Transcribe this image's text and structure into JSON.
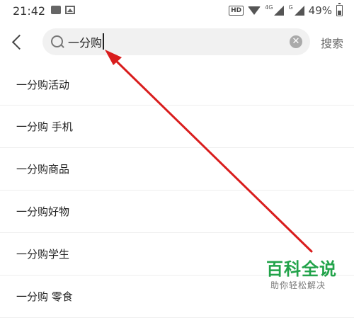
{
  "status_bar": {
    "time": "21:42",
    "hd_label": "HD",
    "net_4g": "4G",
    "net_g": "G",
    "battery": "49%"
  },
  "search": {
    "value": "一分购",
    "button_label": "搜索"
  },
  "suggestions": [
    "一分购活动",
    "一分购 手机",
    "一分购商品",
    "一分购好物",
    "一分购学生",
    "一分购 零食"
  ],
  "watermark": {
    "title": "百科全说",
    "subtitle": "助你轻松解决"
  },
  "colors": {
    "arrow": "#d91d1d",
    "watermark": "#22a34a"
  }
}
